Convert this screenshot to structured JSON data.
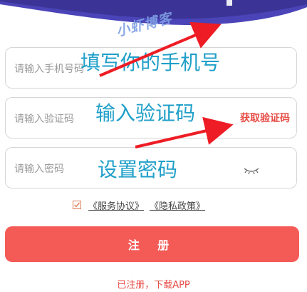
{
  "watermark": "小虾博客",
  "form": {
    "phone_placeholder": "请输入手机号码",
    "code_placeholder": "请输入验证码",
    "password_placeholder": "请输入密码",
    "get_code_label": "获取验证码"
  },
  "annotations": {
    "phone": "填写你的手机号",
    "code": "输入验证码",
    "password": "设置密码"
  },
  "agreement": {
    "checked": true,
    "service_link": "《服务协议》",
    "privacy_link": "《隐私政策》"
  },
  "register_button": "注 册",
  "download_link": "已注册，下载APP",
  "colors": {
    "accent": "#f45b57",
    "link_red": "#e74c45",
    "annotation_blue": "#1f9fc9",
    "arrow_red": "#ee1c24"
  }
}
